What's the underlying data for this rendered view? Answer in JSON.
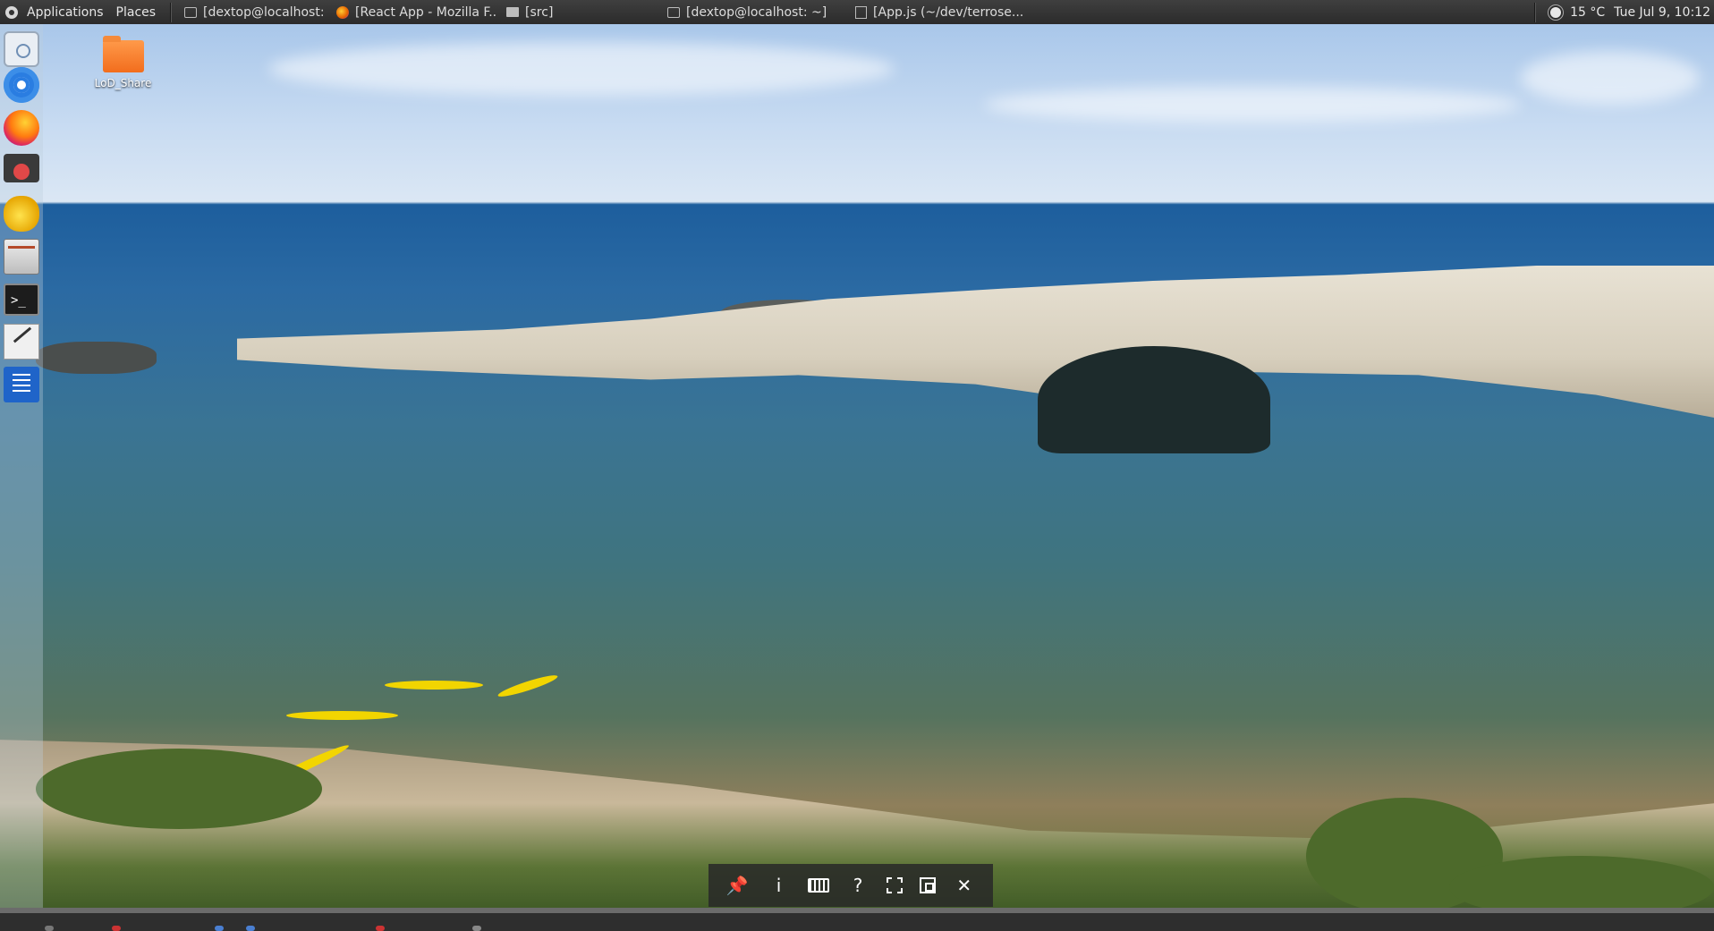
{
  "top_panel": {
    "applications_label": "Applications",
    "places_label": "Places",
    "tasks": [
      {
        "label": "[dextop@localhost: ~...",
        "icon": "terminal-icon"
      },
      {
        "label": "[React App - Mozilla F...",
        "icon": "firefox-icon"
      },
      {
        "label": "[src]",
        "icon": "folder-icon"
      },
      {
        "label": "[dextop@localhost: ~]",
        "icon": "terminal-icon"
      },
      {
        "label": "[App.js (~/dev/terrose...",
        "icon": "text-editor-icon"
      }
    ],
    "weather": "15 °C",
    "clock": "Tue Jul  9, 10:12"
  },
  "desktop": {
    "icons": [
      {
        "label": "LoD_Share",
        "icon": "folder-icon"
      }
    ]
  },
  "dock": {
    "items": [
      "software-store-icon",
      "chrome-icon",
      "firefox-icon",
      "blocked-app-icon",
      "teapot-app-icon",
      "file-drawer-icon",
      "terminal-icon",
      "text-editor-icon",
      "document-viewer-icon"
    ],
    "terminal_glyph": ">_"
  },
  "viewer_toolbar": {
    "pin": "📌",
    "info": "i",
    "help": "?",
    "close": "✕"
  },
  "colors": {
    "panel_bg": "#2f2f2f",
    "accent_folder": "#f26d1d"
  }
}
